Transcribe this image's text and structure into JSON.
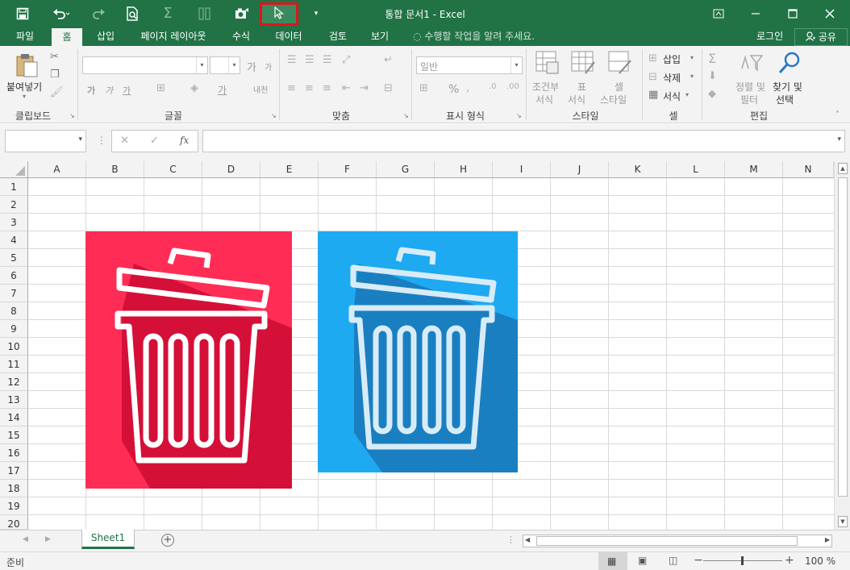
{
  "window": {
    "title": "통합 문서1 - Excel",
    "accent": "#217346"
  },
  "quick_access": {
    "highlight_color": "#e3131b"
  },
  "ribbon": {
    "tabs": [
      {
        "label": "파일"
      },
      {
        "label": "홈"
      },
      {
        "label": "삽입"
      },
      {
        "label": "페이지 레이아웃"
      },
      {
        "label": "수식"
      },
      {
        "label": "데이터"
      },
      {
        "label": "검토"
      },
      {
        "label": "보기"
      }
    ],
    "active_tab": "홈",
    "tell_me": "수행할 작업을 알려 주세요.",
    "login": "로그인",
    "share": "공유",
    "groups": {
      "clipboard": {
        "label": "클립보드",
        "paste": "붙여넣기"
      },
      "font": {
        "label": "글꼴",
        "grow": "가",
        "bold": "가",
        "italic": "가",
        "underline": "가",
        "font_color": "가",
        "phonetic": "내천"
      },
      "alignment": {
        "label": "맞춤"
      },
      "number": {
        "label": "표시 형식",
        "format": "일반",
        "percent": "%"
      },
      "styles": {
        "label": "스타일",
        "conditional": [
          "조건부",
          "서식"
        ],
        "table": [
          "표",
          "서식"
        ],
        "cell": [
          "셀",
          "스타일"
        ]
      },
      "cells": {
        "label": "셀",
        "insert": "삽입",
        "delete": "삭제",
        "format": "서식"
      },
      "editing": {
        "label": "편집",
        "sort": [
          "정렬 및",
          "필터"
        ],
        "find": [
          "찾기 및",
          "선택"
        ]
      }
    }
  },
  "formula_bar": {
    "name_box": "",
    "formula": "",
    "fx": "fx"
  },
  "sheet": {
    "columns": [
      "A",
      "B",
      "C",
      "D",
      "E",
      "F",
      "G",
      "H",
      "I",
      "J",
      "K",
      "L",
      "M",
      "N"
    ],
    "rows": [
      "1",
      "2",
      "3",
      "4",
      "5",
      "6",
      "7",
      "8",
      "9",
      "10",
      "11",
      "12",
      "13",
      "14",
      "15",
      "16",
      "17",
      "18",
      "19",
      "20"
    ],
    "pictures": [
      {
        "name": "red-trash-image",
        "bg": "#ff2d55",
        "shadow": "#d41038"
      },
      {
        "name": "blue-trash-image",
        "bg": "#1eaaf1",
        "shadow": "#1a7fc1"
      }
    ]
  },
  "sheet_tabs": [
    {
      "label": "Sheet1"
    }
  ],
  "status": {
    "ready": "준비",
    "zoom": "100 %"
  }
}
